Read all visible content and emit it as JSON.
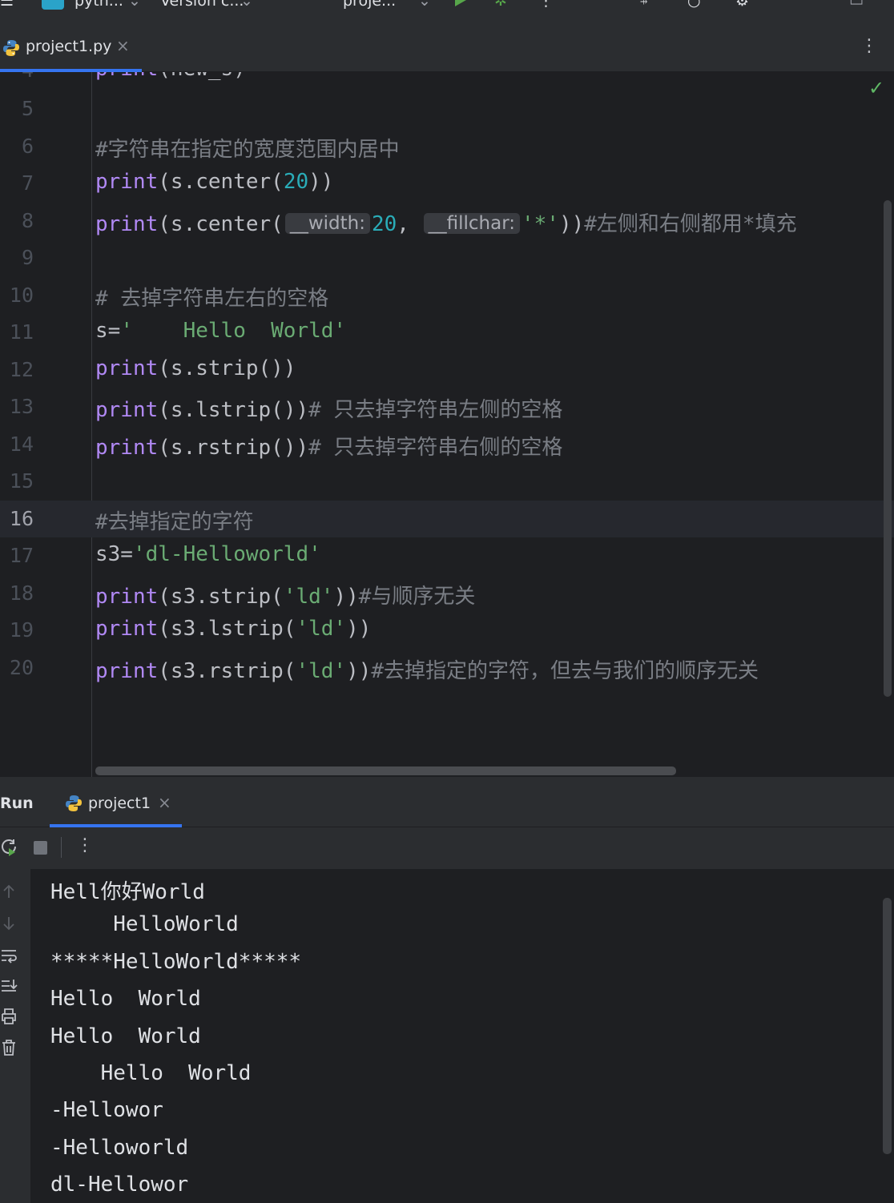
{
  "toolbar": {
    "project_name": "pyth...",
    "vcs": "Version c...",
    "run_config": "proje..."
  },
  "editor_tab": {
    "filename": "project1.py",
    "close_glyph": "×",
    "more_glyph": "⋮"
  },
  "editor": {
    "partial_top_line": "print(new_s)",
    "lines": [
      {
        "n": "5",
        "segments": []
      },
      {
        "n": "6",
        "segments": [
          {
            "t": "#字符串在指定的宽度范围内居中",
            "c": "cmt"
          }
        ]
      },
      {
        "n": "7",
        "segments": [
          {
            "t": "print",
            "c": "kw"
          },
          {
            "t": "(s.center(",
            "c": "plain"
          },
          {
            "t": "20",
            "c": "num"
          },
          {
            "t": "))",
            "c": "plain"
          }
        ]
      },
      {
        "n": "8",
        "segments": [
          {
            "t": "print",
            "c": "kw"
          },
          {
            "t": "(s.center(",
            "c": "plain"
          },
          {
            "t": "__width:",
            "c": "hint"
          },
          {
            "t": "20",
            "c": "num"
          },
          {
            "t": ", ",
            "c": "plain"
          },
          {
            "t": "__fillchar:",
            "c": "hint"
          },
          {
            "t": "'*'",
            "c": "str"
          },
          {
            "t": "))",
            "c": "plain"
          },
          {
            "t": "#左侧和右侧都用*填充",
            "c": "cmt"
          }
        ]
      },
      {
        "n": "9",
        "segments": []
      },
      {
        "n": "10",
        "segments": [
          {
            "t": "# 去掉字符串左右的空格",
            "c": "cmt"
          }
        ]
      },
      {
        "n": "11",
        "segments": [
          {
            "t": "s=",
            "c": "plain"
          },
          {
            "t": "'    Hello  World'",
            "c": "str"
          }
        ]
      },
      {
        "n": "12",
        "segments": [
          {
            "t": "print",
            "c": "kw"
          },
          {
            "t": "(s.strip())",
            "c": "plain"
          }
        ]
      },
      {
        "n": "13",
        "segments": [
          {
            "t": "print",
            "c": "kw"
          },
          {
            "t": "(s.lstrip())",
            "c": "plain"
          },
          {
            "t": "# 只去掉字符串左侧的空格",
            "c": "cmt"
          }
        ]
      },
      {
        "n": "14",
        "segments": [
          {
            "t": "print",
            "c": "kw"
          },
          {
            "t": "(s.rstrip())",
            "c": "plain"
          },
          {
            "t": "# 只去掉字符串右侧的空格",
            "c": "cmt"
          }
        ]
      },
      {
        "n": "15",
        "segments": []
      },
      {
        "n": "16",
        "current": true,
        "segments": [
          {
            "t": "#去掉指定的字符",
            "c": "cmt"
          }
        ]
      },
      {
        "n": "17",
        "segments": [
          {
            "t": "s3=",
            "c": "plain"
          },
          {
            "t": "'dl-Helloworld'",
            "c": "str"
          }
        ]
      },
      {
        "n": "18",
        "segments": [
          {
            "t": "print",
            "c": "kw"
          },
          {
            "t": "(s3.strip(",
            "c": "plain"
          },
          {
            "t": "'ld'",
            "c": "str"
          },
          {
            "t": "))",
            "c": "plain"
          },
          {
            "t": "#与顺序无关",
            "c": "cmt"
          }
        ]
      },
      {
        "n": "19",
        "segments": [
          {
            "t": "print",
            "c": "kw"
          },
          {
            "t": "(s3.lstrip(",
            "c": "plain"
          },
          {
            "t": "'ld'",
            "c": "str"
          },
          {
            "t": "))",
            "c": "plain"
          }
        ]
      },
      {
        "n": "20",
        "segments": [
          {
            "t": "print",
            "c": "kw"
          },
          {
            "t": "(s3.rstrip(",
            "c": "plain"
          },
          {
            "t": "'ld'",
            "c": "str"
          },
          {
            "t": "))",
            "c": "plain"
          },
          {
            "t": "#去掉指定的字符，但去与我们的顺序无关",
            "c": "cmt"
          }
        ]
      }
    ]
  },
  "run_panel": {
    "title": "Run",
    "tab_label": "project1",
    "close_glyph": "×",
    "more_glyph": "⋮",
    "output": [
      "Hell你好World",
      "     HelloWorld",
      "*****HelloWorld*****",
      "Hello  World",
      "Hello  World",
      "    Hello  World",
      "-Hellowor",
      "-Helloworld",
      "dl-Hellowor"
    ]
  },
  "colors": {
    "keyword": "#b189f5",
    "number": "#2aacb8",
    "string": "#6aab73",
    "comment": "#7a7e85",
    "accent": "#3574f0",
    "ok": "#5fb865"
  },
  "icons": {
    "file_tab": "python-file-icon",
    "run_tab": "python-file-icon",
    "status": "check-icon",
    "rerun": "rerun-icon",
    "stop": "stop-icon",
    "side": [
      "arrow-up-icon",
      "arrow-down-icon",
      "soft-wrap-icon",
      "scroll-to-end-icon",
      "print-icon",
      "trash-icon"
    ]
  }
}
